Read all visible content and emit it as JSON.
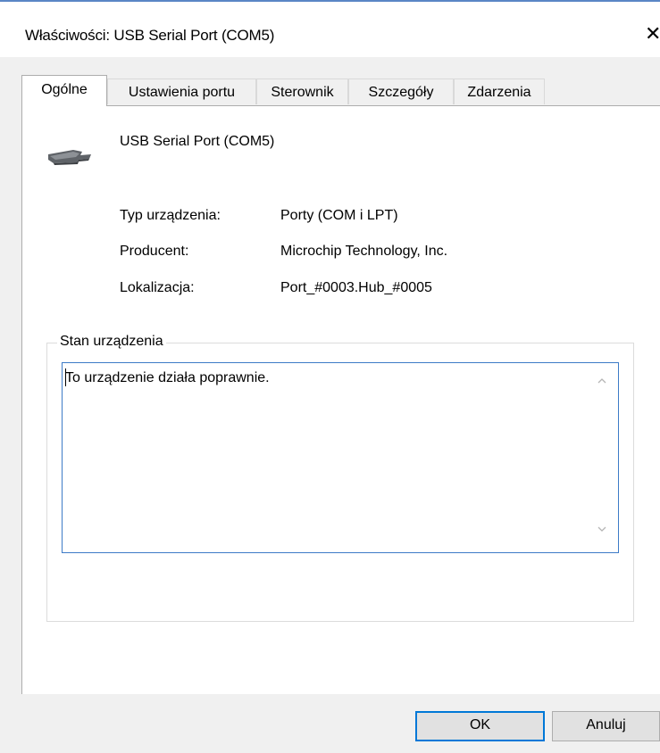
{
  "window": {
    "title": "Właściwości: USB Serial Port (COM5)",
    "close_glyph": "✕"
  },
  "tabs": [
    {
      "label": "Ogólne",
      "active": true
    },
    {
      "label": "Ustawienia portu",
      "active": false
    },
    {
      "label": "Sterownik",
      "active": false
    },
    {
      "label": "Szczegóły",
      "active": false
    },
    {
      "label": "Zdarzenia",
      "active": false
    }
  ],
  "device": {
    "icon": "serial-port-connector-icon",
    "name": "USB Serial Port (COM5)"
  },
  "properties": [
    {
      "label": "Typ urządzenia:",
      "value": "Porty (COM i LPT)"
    },
    {
      "label": "Producent:",
      "value": "Microchip Technology, Inc."
    },
    {
      "label": "Lokalizacja:",
      "value": "Port_#0003.Hub_#0005"
    }
  ],
  "status": {
    "group_label": "Stan urządzenia",
    "text": "To urządzenie działa poprawnie."
  },
  "buttons": {
    "ok": "OK",
    "cancel": "Anuluj"
  },
  "colors": {
    "focus_border": "#3d7bc7",
    "default_button_border": "#0078d7",
    "dialog_background": "#f0f0f0"
  }
}
